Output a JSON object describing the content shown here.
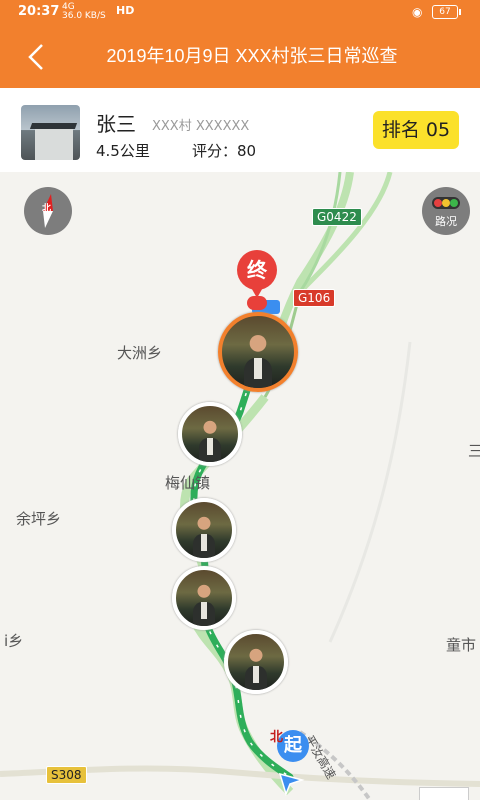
{
  "status_bar": {
    "time": "20:37",
    "network": "4G",
    "speed": "36.0 KB/S",
    "hd": "HD",
    "battery": "67"
  },
  "header": {
    "title": "2019年10月9日  XXX村张三日常巡查",
    "back_icon": "chevron-left-icon"
  },
  "profile": {
    "name": "张三",
    "village": "XXX村  XXXXXX",
    "distance": "4.5公里",
    "score": "评分：80",
    "rank": "排名  05"
  },
  "map": {
    "compass_label": "北",
    "traffic_label": "路况",
    "end_label": "终",
    "start_label": "起",
    "start_north": "北",
    "places": [
      "大洲乡",
      "梅仙镇",
      "余坪乡",
      "i乡",
      "童市",
      "三",
      "平汝高速"
    ],
    "roads": [
      "G0422",
      "G106",
      "S308"
    ],
    "colors": {
      "accent": "#f2802d",
      "route": "#2eae5a",
      "end": "#e8403a",
      "start": "#3b8ef0",
      "rank_bg": "#fbe12b"
    }
  }
}
